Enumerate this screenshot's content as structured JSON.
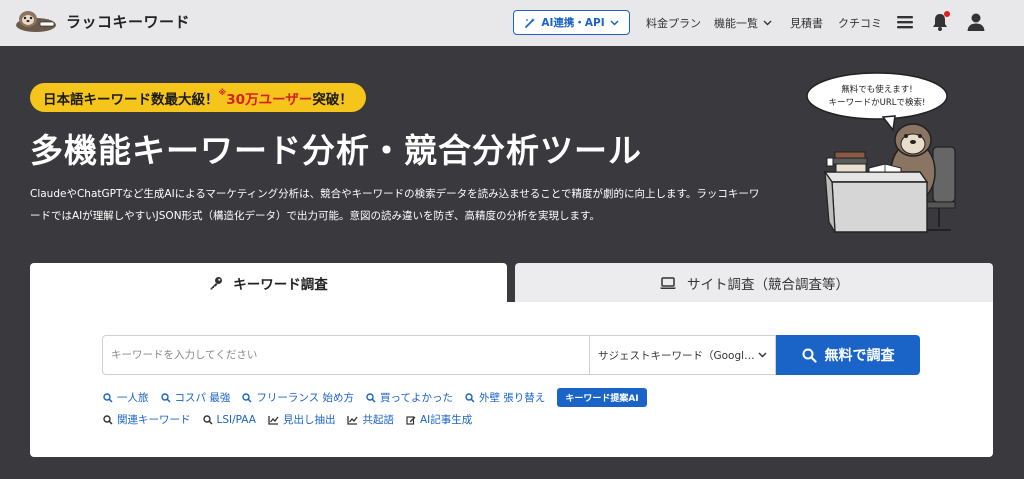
{
  "header": {
    "logo_text": "ラッコキーワード",
    "ai_button_label": "AI連携・API",
    "nav": [
      {
        "label": "料金プラン"
      },
      {
        "label": "機能一覧"
      },
      {
        "label": "見積書"
      },
      {
        "label": "クチコミ"
      }
    ],
    "icons": [
      "menu-icon",
      "bell-icon",
      "user-icon"
    ],
    "notification_dot_color": "#e02020"
  },
  "hero": {
    "badge": {
      "prefix": "日本語キーワード数最大級！",
      "mark": "※",
      "highlight": "30万ユーザー",
      "suffix": "突破！"
    },
    "title": "多機能キーワード分析・競合分析ツール",
    "description": "ClaudeやChatGPTなど生成AIによるマーケティング分析は、競合やキーワードの検索データを読み込ませることで精度が劇的に向上します。ラッコキーワードではAIが理解しやすいJSON形式（構造化データ）で出力可能。意図の読み違いを防ぎ、高精度の分析を実現します。",
    "speech_bubble": [
      "無料でも使えます!",
      "キーワードかURLで検索!"
    ]
  },
  "tabs": [
    {
      "label": "キーワード調査",
      "icon": "key-icon",
      "active": true
    },
    {
      "label": "サイト調査（競合調査等）",
      "icon": "laptop-icon",
      "active": false
    }
  ],
  "search": {
    "placeholder": "キーワードを入力してください",
    "value": "",
    "select_value": "サジェストキーワード（Googl…",
    "button_label": "無料で調査"
  },
  "suggestions_row1": [
    {
      "label": "一人旅",
      "icon": "search-icon"
    },
    {
      "label": "コスパ 最強",
      "icon": "search-icon"
    },
    {
      "label": "フリーランス 始め方",
      "icon": "search-icon"
    },
    {
      "label": "買ってよかった",
      "icon": "search-icon"
    },
    {
      "label": "外壁 張り替え",
      "icon": "search-icon"
    }
  ],
  "suggest_ai_button": "キーワード提案AI",
  "tools_row2": [
    {
      "label": "関連キーワード",
      "icon": "search-icon"
    },
    {
      "label": "LSI/PAA",
      "icon": "search-icon"
    },
    {
      "label": "見出し抽出",
      "icon": "chart-icon"
    },
    {
      "label": "共起語",
      "icon": "chart-icon"
    },
    {
      "label": "AI記事生成",
      "icon": "edit-icon"
    }
  ],
  "colors": {
    "brand_blue": "#1a64c8",
    "hero_bg": "#3a3a3e",
    "badge_yellow": "#f5c51b",
    "highlight_red": "#d81e1e"
  }
}
